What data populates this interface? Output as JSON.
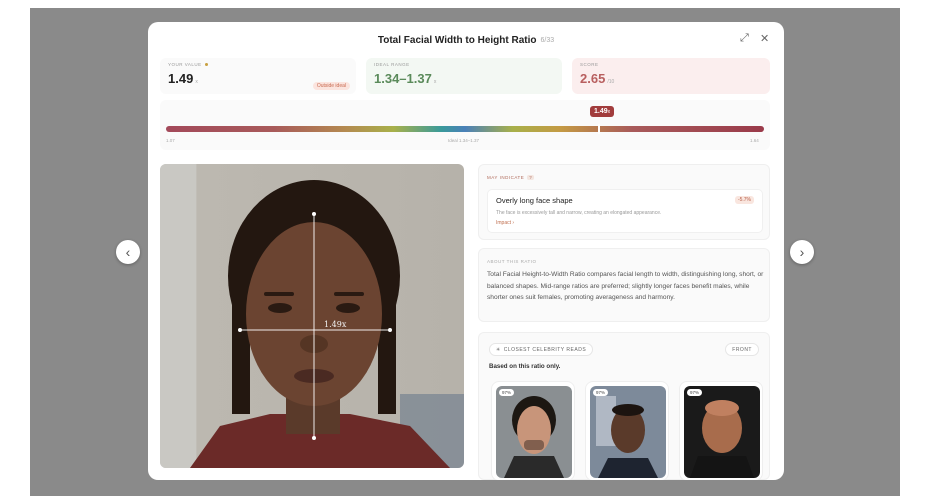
{
  "modal": {
    "title": "Total Facial Width to Height Ratio",
    "counter": "6/33"
  },
  "stats": {
    "your_value": {
      "label": "YOUR VALUE",
      "value": "1.49",
      "unit": "x",
      "badge": "Outside ideal"
    },
    "ideal_range": {
      "label": "IDEAL RANGE",
      "value": "1.34–1.37",
      "unit": "x"
    },
    "score": {
      "label": "SCORE",
      "value": "2.65",
      "unit": "/10"
    }
  },
  "range": {
    "min_label": "1.07",
    "ideal_label": "Ideal 1.34–1.37",
    "max_label": "1.64",
    "value_label": "1.49",
    "value_unit": "x"
  },
  "photo": {
    "overlay_label": "1.49x"
  },
  "may_indicate": {
    "label": "MAY INDICATE",
    "badge": "?",
    "item_title": "Overly long face shape",
    "item_desc": "The face is excessively tall and narrow, creating an elongated appearance.",
    "impact_label": "Impact ›",
    "percent": "-5.7%"
  },
  "about": {
    "label": "ABOUT THIS RATIO",
    "text": "Total Facial Height-to-Width Ratio compares facial length to width, distinguishing long, short, or balanced shapes. Mid-range ratios are preferred; slightly longer faces benefit males, while shorter ones suit females, promoting averageness and harmony."
  },
  "celebrity": {
    "pill_label": "CLOSEST CELEBRITY READS",
    "front_label": "FRONT",
    "sub": "Based on this ratio only.",
    "matches": [
      {
        "match": "97%"
      },
      {
        "match": "97%"
      },
      {
        "match": "97%"
      }
    ]
  },
  "colors": {
    "score": "#b85f5f",
    "ideal": "#5a8a5a",
    "marker": "#a13c3c"
  },
  "icons": {
    "prev": "chevron-left-icon",
    "next": "chevron-right-icon",
    "expand": "expand-icon",
    "close": "close-icon"
  }
}
